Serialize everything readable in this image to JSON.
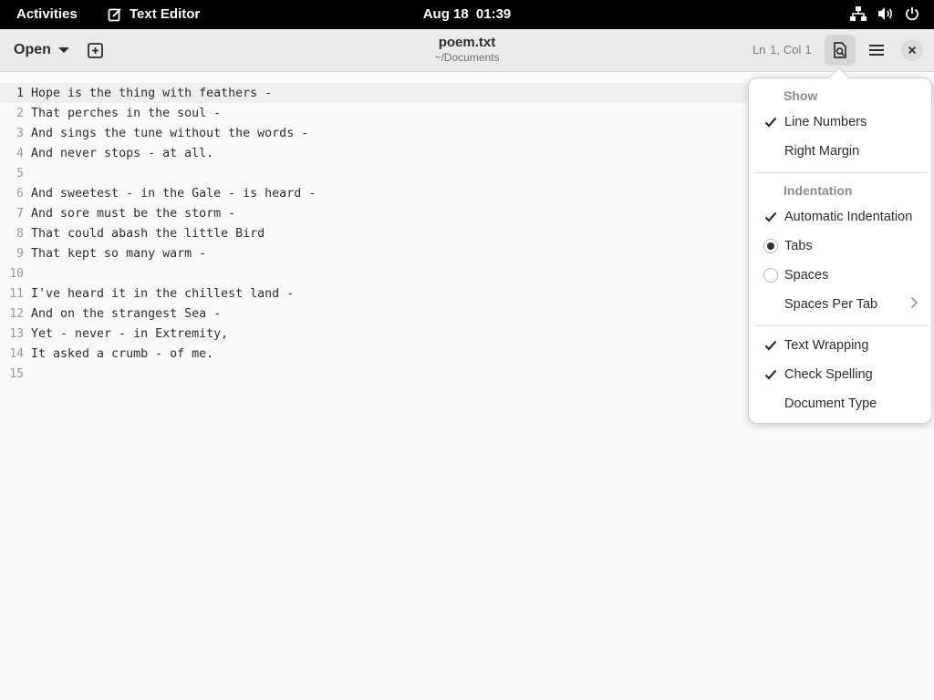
{
  "topbar": {
    "activities": "Activities",
    "app_name": "Text Editor",
    "date": "Aug 18",
    "time": "01:39",
    "icons": [
      "network-icon",
      "volume-icon",
      "power-icon"
    ]
  },
  "header": {
    "open_label": "Open",
    "title": "poem.txt",
    "subtitle": "~/Documents",
    "ln_label": "Ln 1,",
    "col_label": "Col",
    "col_value": "1"
  },
  "editor": {
    "lines": [
      {
        "num": "1",
        "text": "Hope is the thing with feathers -"
      },
      {
        "num": "2",
        "text": "That perches in the soul -"
      },
      {
        "num": "3",
        "text": "And sings the tune without the words -"
      },
      {
        "num": "4",
        "text": "And never stops - at all."
      },
      {
        "num": "5",
        "text": ""
      },
      {
        "num": "6",
        "text": "And sweetest - in the Gale - is heard -"
      },
      {
        "num": "7",
        "text": "And sore must be the storm -"
      },
      {
        "num": "8",
        "text": "That could abash the little Bird"
      },
      {
        "num": "9",
        "text": "That kept so many warm -"
      },
      {
        "num": "10",
        "text": ""
      },
      {
        "num": "11",
        "text": "I've heard it in the chillest land -"
      },
      {
        "num": "12",
        "text": "And on the strangest Sea -"
      },
      {
        "num": "13",
        "text": "Yet - never - in Extremity,"
      },
      {
        "num": "14",
        "text": "It asked a crumb - of me."
      },
      {
        "num": "15",
        "text": ""
      }
    ]
  },
  "menu": {
    "show_heading": "Show",
    "line_numbers": "Line Numbers",
    "right_margin": "Right Margin",
    "indentation_heading": "Indentation",
    "auto_indent": "Automatic Indentation",
    "tabs": "Tabs",
    "spaces": "Spaces",
    "spaces_per_tab": "Spaces Per Tab",
    "text_wrapping": "Text Wrapping",
    "check_spelling": "Check Spelling",
    "document_type": "Document Type"
  },
  "colors": {
    "topbar_bg": "#000000",
    "headerbar_bg": "#ebebeb",
    "editor_bg": "#fafafa",
    "current_line_bg": "#f0f0f0"
  }
}
